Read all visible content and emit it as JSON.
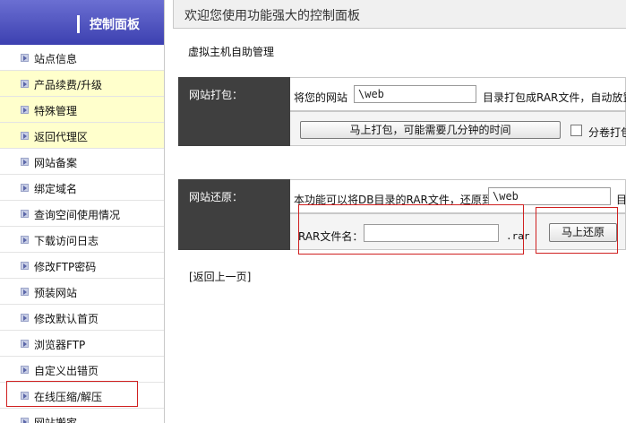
{
  "sidebar": {
    "title": "控制面板",
    "items": [
      {
        "label": "站点信息"
      },
      {
        "label": "产品续费/升级"
      },
      {
        "label": "特殊管理"
      },
      {
        "label": "返回代理区"
      },
      {
        "label": "网站备案"
      },
      {
        "label": "绑定域名"
      },
      {
        "label": "查询空间使用情况"
      },
      {
        "label": "下载访问日志"
      },
      {
        "label": "修改FTP密码"
      },
      {
        "label": "预装网站"
      },
      {
        "label": "修改默认首页"
      },
      {
        "label": "浏览器FTP"
      },
      {
        "label": "自定义出错页"
      },
      {
        "label": "在线压缩/解压"
      },
      {
        "label": "网站搬家"
      }
    ]
  },
  "header": {
    "welcome": "欢迎您使用功能强大的控制面板"
  },
  "main": {
    "subtitle": "虚拟主机自助管理",
    "pack": {
      "label": "网站打包：",
      "prefix": "将您的网站",
      "dir_value": "\\web",
      "suffix": "目录打包成RAR文件，自动放置",
      "button": "马上打包，可能需要几分钟的时间",
      "split_label": "分卷打包"
    },
    "restore": {
      "label": "网站还原：",
      "desc": "本功能可以将DB目录的RAR文件，还原到",
      "dir_value": "\\web",
      "trail": "目",
      "file_label": "RAR文件名：",
      "file_value": "",
      "ext": ".rar",
      "button": "马上还原"
    },
    "back": "[返回上一页]"
  }
}
